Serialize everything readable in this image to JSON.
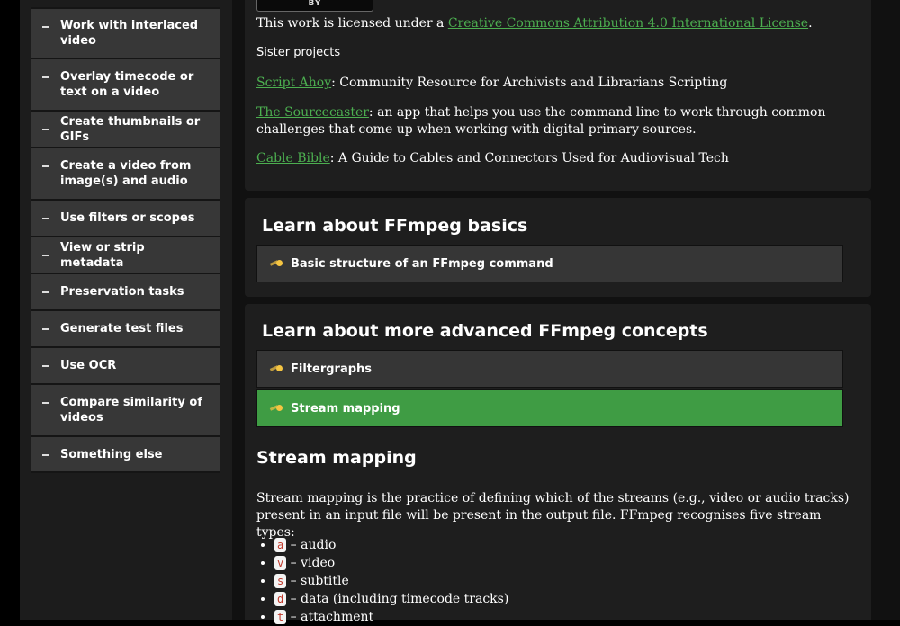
{
  "sidebar": {
    "items": [
      {
        "label": "Work with interlaced video"
      },
      {
        "label": "Overlay timecode or text on a video"
      },
      {
        "label": "Create thumbnails or GIFs"
      },
      {
        "label": "Create a video from image(s) and audio"
      },
      {
        "label": "Use filters or scopes"
      },
      {
        "label": "View or strip metadata"
      },
      {
        "label": "Preservation tasks"
      },
      {
        "label": "Generate test files"
      },
      {
        "label": "Use OCR"
      },
      {
        "label": "Compare similarity of videos"
      },
      {
        "label": "Something else"
      }
    ]
  },
  "license": {
    "badge": "BY",
    "prefix": "This work is licensed under a ",
    "link": "Creative Commons Attribution 4.0 International License",
    "suffix": "."
  },
  "sister": {
    "heading": "Sister projects",
    "projects": [
      {
        "link": "Script Ahoy",
        "text": ": Community Resource for Archivists and Librarians Scripting"
      },
      {
        "link": "The Sourcecaster",
        "text": ": an app that helps you use the command line to work through common challenges that come up when working with digital primary sources."
      },
      {
        "link": "Cable Bible",
        "text": ": A Guide to Cables and Connectors Used for Audiovisual Tech"
      }
    ]
  },
  "basics": {
    "title": "Learn about FFmpeg basics",
    "items": [
      {
        "label": "Basic structure of an FFmpeg command"
      }
    ]
  },
  "advanced": {
    "title": "Learn about more advanced FFmpeg concepts",
    "items": [
      {
        "label": "Filtergraphs"
      },
      {
        "label": "Stream mapping"
      }
    ]
  },
  "section": {
    "title": "Stream mapping",
    "intro": "Stream mapping is the practice of defining which of the streams (e.g., video or audio tracks) present in an input file will be present in the output file. FFmpeg recognises five stream types:",
    "streams": [
      {
        "code": "a",
        "desc": " – audio"
      },
      {
        "code": "v",
        "desc": " – video"
      },
      {
        "code": "s",
        "desc": " – subtitle"
      },
      {
        "code": "d",
        "desc": " – data (including timecode tracks)"
      },
      {
        "code": "t",
        "desc": " – attachment"
      }
    ]
  },
  "colors": {
    "accent": "#3f9c44",
    "link": "#4caf50",
    "code": "#c0392b"
  },
  "icons": {
    "accordion": "comet-icon",
    "nav": "dash-icon"
  }
}
